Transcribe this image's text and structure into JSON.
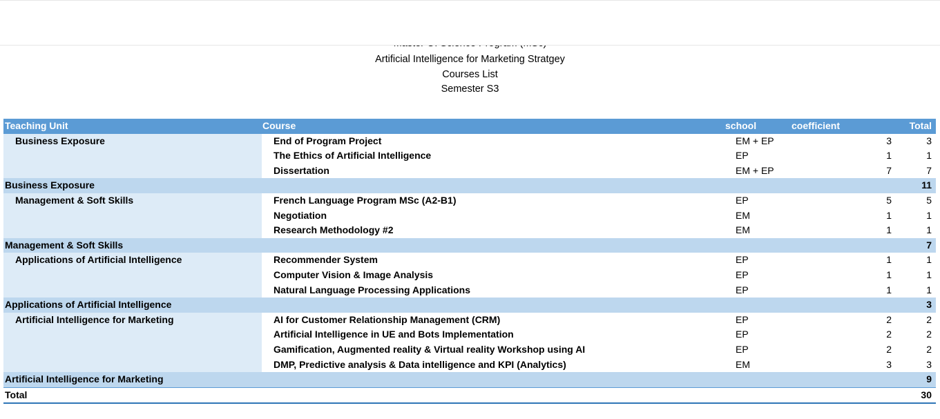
{
  "header": {
    "line1": "Master Of Science Program (MSc)",
    "line2": "Artificial Intelligence for Marketing Stratgey",
    "line3": "Courses List",
    "line4": "Semester S3"
  },
  "table": {
    "columns": {
      "unit": "Teaching Unit",
      "course": "Course",
      "school": "school",
      "coefficient": "coefficient",
      "total": "Total"
    },
    "groups": [
      {
        "unit": "Business Exposure",
        "courses": [
          {
            "course": "End of Program Project",
            "school": "EM + EP",
            "coefficient": "3",
            "total": "3"
          },
          {
            "course": "The Ethics of Artificial Intelligence",
            "school": "EP",
            "coefficient": "1",
            "total": "1"
          },
          {
            "course": "Dissertation",
            "school": "EM + EP",
            "coefficient": "7",
            "total": "7"
          }
        ],
        "subtotal_label": "Business Exposure",
        "subtotal": "11"
      },
      {
        "unit": "Management & Soft Skills",
        "courses": [
          {
            "course": "French Language Program MSc (A2-B1)",
            "school": "EP",
            "coefficient": "5",
            "total": "5"
          },
          {
            "course": "Negotiation",
            "school": "EM",
            "coefficient": "1",
            "total": "1"
          },
          {
            "course": "Research Methodology #2",
            "school": "EM",
            "coefficient": "1",
            "total": "1"
          }
        ],
        "subtotal_label": "Management & Soft Skills",
        "subtotal": "7"
      },
      {
        "unit": "Applications of Artificial Intelligence",
        "courses": [
          {
            "course": "Recommender System",
            "school": "EP",
            "coefficient": "1",
            "total": "1"
          },
          {
            "course": "Computer Vision & Image Analysis",
            "school": "EP",
            "coefficient": "1",
            "total": "1"
          },
          {
            "course": "Natural Language Processing Applications",
            "school": "EP",
            "coefficient": "1",
            "total": "1"
          }
        ],
        "subtotal_label": "Applications of Artificial Intelligence",
        "subtotal": "3"
      },
      {
        "unit": "Artificial Intelligence for Marketing",
        "courses": [
          {
            "course": "AI for Customer Relationship Management (CRM)",
            "school": "EP",
            "coefficient": "2",
            "total": "2"
          },
          {
            "course": "Artificial Intelligence in UE and Bots Implementation",
            "school": "EP",
            "coefficient": "2",
            "total": "2"
          },
          {
            "course": "Gamification, Augmented reality & Virtual reality Workshop using AI",
            "school": "EP",
            "coefficient": "2",
            "total": "2"
          },
          {
            "course": "DMP, Predictive analysis & Data intelligence and KPI (Analytics)",
            "school": "EM",
            "coefficient": "3",
            "total": "3"
          }
        ],
        "subtotal_label": "Artificial Intelligence for Marketing",
        "subtotal": "9"
      }
    ],
    "grand_total_label": "Total",
    "grand_total": "30"
  }
}
